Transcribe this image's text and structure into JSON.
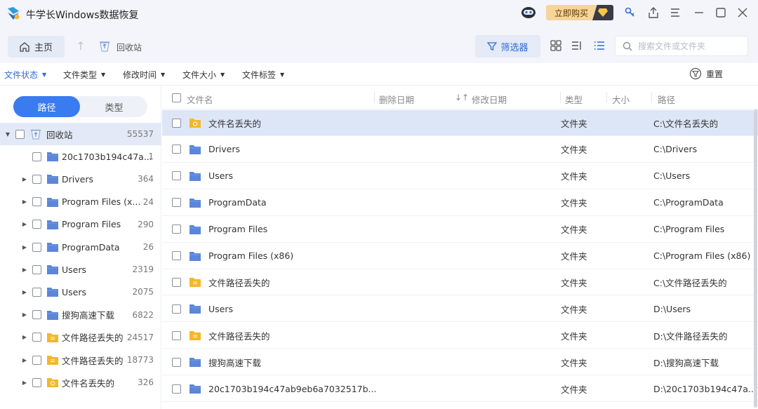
{
  "app": {
    "title": "牛学长Windows数据恢复",
    "buy_label": "立即购买"
  },
  "toolbar": {
    "home_label": "主页",
    "breadcrumb_label": "回收站",
    "filter_label": "筛选器",
    "search_placeholder": "搜索文件或文件夹"
  },
  "filters": {
    "items": [
      {
        "label": "文件状态"
      },
      {
        "label": "文件类型"
      },
      {
        "label": "修改时间"
      },
      {
        "label": "文件大小"
      },
      {
        "label": "文件标签"
      }
    ],
    "reset_label": "重置"
  },
  "sidebar": {
    "tabs": [
      {
        "label": "路径"
      },
      {
        "label": "类型"
      }
    ],
    "tree": [
      {
        "label": "回收站",
        "count": "55537",
        "icon": "recycle-bin-icon"
      },
      {
        "label": "20c1703b194c47a...",
        "count": "1",
        "icon": "folder-icon"
      },
      {
        "label": "Drivers",
        "count": "364",
        "icon": "folder-icon"
      },
      {
        "label": "Program Files (x...",
        "count": "24",
        "icon": "folder-icon"
      },
      {
        "label": "Program Files",
        "count": "290",
        "icon": "folder-icon"
      },
      {
        "label": "ProgramData",
        "count": "26",
        "icon": "folder-icon"
      },
      {
        "label": "Users",
        "count": "2319",
        "icon": "folder-icon"
      },
      {
        "label": "Users",
        "count": "2075",
        "icon": "folder-icon"
      },
      {
        "label": "搜狗高速下载",
        "count": "6822",
        "icon": "folder-icon"
      },
      {
        "label": "文件路径丢失的",
        "count": "24517",
        "icon": "lost-path-folder-icon"
      },
      {
        "label": "文件路径丢失的",
        "count": "18773",
        "icon": "lost-path-folder-icon"
      },
      {
        "label": "文件名丢失的",
        "count": "326",
        "icon": "lost-name-folder-icon"
      }
    ]
  },
  "table": {
    "headers": {
      "name": "文件名",
      "deleted": "删除日期",
      "modified": "修改日期",
      "type": "类型",
      "size": "大小",
      "path": "路径"
    },
    "rows": [
      {
        "name": "文件名丢失的",
        "type": "文件夹",
        "path": "C:\\文件名丢失的",
        "icon": "lost-name-folder-icon"
      },
      {
        "name": "Drivers",
        "type": "文件夹",
        "path": "C:\\Drivers",
        "icon": "folder-icon"
      },
      {
        "name": "Users",
        "type": "文件夹",
        "path": "C:\\Users",
        "icon": "folder-icon"
      },
      {
        "name": "ProgramData",
        "type": "文件夹",
        "path": "C:\\ProgramData",
        "icon": "folder-icon"
      },
      {
        "name": "Program Files",
        "type": "文件夹",
        "path": "C:\\Program Files",
        "icon": "folder-icon"
      },
      {
        "name": "Program Files (x86)",
        "type": "文件夹",
        "path": "C:\\Program Files (x86)",
        "icon": "folder-icon"
      },
      {
        "name": "文件路径丢失的",
        "type": "文件夹",
        "path": "C:\\文件路径丢失的",
        "icon": "lost-path-folder-icon"
      },
      {
        "name": "Users",
        "type": "文件夹",
        "path": "D:\\Users",
        "icon": "folder-icon"
      },
      {
        "name": "文件路径丢失的",
        "type": "文件夹",
        "path": "D:\\文件路径丢失的",
        "icon": "lost-path-folder-icon"
      },
      {
        "name": "搜狗高速下载",
        "type": "文件夹",
        "path": "D:\\搜狗高速下载",
        "icon": "folder-icon"
      },
      {
        "name": "20c1703b194c47ab9eb6a7032517b...",
        "type": "文件夹",
        "path": "D:\\20c1703b194c47a...",
        "icon": "folder-icon"
      }
    ]
  },
  "colors": {
    "accent": "#3b7bf0",
    "folder_blue": "#5b86d9",
    "folder_yellow": "#f5b72a",
    "selected_row": "#dde6f7"
  }
}
